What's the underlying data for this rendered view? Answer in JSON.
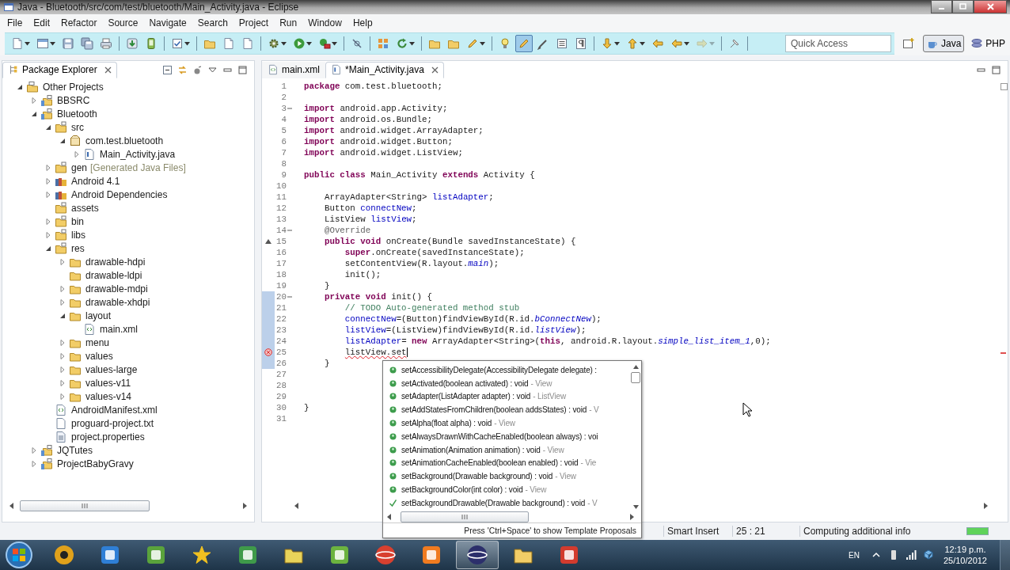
{
  "window": {
    "title": "Java - Bluetooth/src/com/test/bluetooth/Main_Activity.java - Eclipse"
  },
  "menu_bar": {
    "items": [
      "File",
      "Edit",
      "Refactor",
      "Source",
      "Navigate",
      "Search",
      "Project",
      "Run",
      "Window",
      "Help"
    ]
  },
  "toolbar": {
    "groups": [
      [
        {
          "kind": "document",
          "dropdown": true,
          "pressed": false,
          "disabled": false
        },
        {
          "kind": "window",
          "dropdown": true,
          "pressed": false,
          "disabled": false
        },
        {
          "kind": "disk",
          "dropdown": false,
          "pressed": false,
          "disabled": false
        },
        {
          "kind": "disks",
          "dropdown": false,
          "pressed": false,
          "disabled": false
        },
        {
          "kind": "printer",
          "dropdown": false,
          "pressed": false,
          "disabled": false
        }
      ],
      [
        {
          "kind": "download",
          "dropdown": false,
          "pressed": false,
          "disabled": false
        },
        {
          "kind": "phone",
          "dropdown": false,
          "pressed": false,
          "disabled": false
        }
      ],
      [
        {
          "kind": "checkbox",
          "dropdown": true,
          "pressed": false,
          "disabled": false
        }
      ],
      [
        {
          "kind": "folder",
          "dropdown": false,
          "pressed": false,
          "disabled": false
        },
        {
          "kind": "document",
          "dropdown": false,
          "pressed": false,
          "disabled": false
        },
        {
          "kind": "document",
          "dropdown": false,
          "pressed": false,
          "disabled": false
        }
      ],
      [
        {
          "kind": "gear",
          "dropdown": true,
          "pressed": false,
          "disabled": false
        },
        {
          "kind": "play",
          "dropdown": true,
          "pressed": false,
          "disabled": false
        },
        {
          "kind": "toolbox",
          "dropdown": true,
          "pressed": false,
          "disabled": false
        }
      ],
      [
        {
          "kind": "slash",
          "dropdown": false,
          "pressed": false,
          "disabled": false
        }
      ],
      [
        {
          "kind": "grid",
          "dropdown": false,
          "pressed": false,
          "disabled": false
        },
        {
          "kind": "refresh",
          "dropdown": true,
          "pressed": false,
          "disabled": false
        }
      ],
      [
        {
          "kind": "folder",
          "dropdown": false,
          "pressed": false,
          "disabled": false
        },
        {
          "kind": "folder",
          "dropdown": false,
          "pressed": false,
          "disabled": false
        },
        {
          "kind": "pencil",
          "dropdown": true,
          "pressed": false,
          "disabled": false
        }
      ],
      [
        {
          "kind": "lamp",
          "dropdown": false,
          "pressed": false,
          "disabled": false
        },
        {
          "kind": "pencil",
          "dropdown": false,
          "pressed": true,
          "disabled": false
        },
        {
          "kind": "pen",
          "dropdown": false,
          "pressed": false,
          "disabled": false
        },
        {
          "kind": "lines",
          "dropdown": false,
          "pressed": false,
          "disabled": false
        },
        {
          "kind": "paragraph",
          "dropdown": false,
          "pressed": false,
          "disabled": false
        }
      ],
      [
        {
          "kind": "arrow-down",
          "dropdown": true,
          "pressed": false,
          "disabled": false
        },
        {
          "kind": "arrow-up",
          "dropdown": true,
          "pressed": false,
          "disabled": false
        },
        {
          "kind": "arrow-left",
          "dropdown": false,
          "pressed": false,
          "disabled": false
        },
        {
          "kind": "arrow-left",
          "dropdown": true,
          "pressed": false,
          "disabled": false
        },
        {
          "kind": "arrow-right",
          "dropdown": true,
          "pressed": false,
          "disabled": true
        }
      ],
      [
        {
          "kind": "pin",
          "dropdown": false,
          "pressed": false,
          "disabled": false
        }
      ]
    ]
  },
  "quick_access": {
    "placeholder": "Quick Access"
  },
  "perspectives": [
    {
      "label": "Java",
      "selected": true
    },
    {
      "label": "PHP",
      "selected": false
    }
  ],
  "package_explorer": {
    "title": "Package Explorer",
    "tree": [
      {
        "label": "Other Projects",
        "kind": "working-set",
        "expandable": true,
        "expanded": true,
        "children": [
          {
            "label": "BBSRC",
            "kind": "project",
            "expandable": true,
            "expanded": false
          },
          {
            "label": "Bluetooth",
            "kind": "project",
            "expandable": true,
            "expanded": true,
            "children": [
              {
                "label": "src",
                "kind": "source-folder",
                "expandable": true,
                "expanded": true,
                "children": [
                  {
                    "label": "com.test.bluetooth",
                    "kind": "package",
                    "expandable": true,
                    "expanded": true,
                    "children": [
                      {
                        "label": "Main_Activity.java",
                        "kind": "java-file",
                        "expandable": true,
                        "expanded": false
                      }
                    ]
                  }
                ]
              },
              {
                "label": "gen",
                "decoration": "[Generated Java Files]",
                "kind": "source-folder",
                "expandable": true,
                "expanded": false
              },
              {
                "label": "Android 4.1",
                "kind": "library",
                "expandable": true,
                "expanded": false
              },
              {
                "label": "Android Dependencies",
                "kind": "library",
                "expandable": true,
                "expanded": false
              },
              {
                "label": "assets",
                "kind": "source-folder",
                "expandable": false,
                "expanded": false
              },
              {
                "label": "bin",
                "kind": "source-folder",
                "expandable": true,
                "expanded": false
              },
              {
                "label": "libs",
                "kind": "source-folder",
                "expandable": true,
                "expanded": false
              },
              {
                "label": "res",
                "kind": "source-folder",
                "expandable": true,
                "expanded": true,
                "children": [
                  {
                    "label": "drawable-hdpi",
                    "kind": "folder",
                    "expandable": true,
                    "expanded": false
                  },
                  {
                    "label": "drawable-ldpi",
                    "kind": "folder",
                    "expandable": false,
                    "expanded": false
                  },
                  {
                    "label": "drawable-mdpi",
                    "kind": "folder",
                    "expandable": true,
                    "expanded": false
                  },
                  {
                    "label": "drawable-xhdpi",
                    "kind": "folder",
                    "expandable": true,
                    "expanded": false
                  },
                  {
                    "label": "layout",
                    "kind": "folder",
                    "expandable": true,
                    "expanded": true,
                    "children": [
                      {
                        "label": "main.xml",
                        "kind": "xml-file",
                        "expandable": false,
                        "expanded": false
                      }
                    ]
                  },
                  {
                    "label": "menu",
                    "kind": "folder",
                    "expandable": true,
                    "expanded": false
                  },
                  {
                    "label": "values",
                    "kind": "folder",
                    "expandable": true,
                    "expanded": false
                  },
                  {
                    "label": "values-large",
                    "kind": "folder",
                    "expandable": true,
                    "expanded": false
                  },
                  {
                    "label": "values-v11",
                    "kind": "folder",
                    "expandable": true,
                    "expanded": false
                  },
                  {
                    "label": "values-v14",
                    "kind": "folder",
                    "expandable": true,
                    "expanded": false
                  }
                ]
              },
              {
                "label": "AndroidManifest.xml",
                "kind": "xml-file",
                "expandable": false,
                "expanded": false
              },
              {
                "label": "proguard-project.txt",
                "kind": "text-file",
                "expandable": false,
                "expanded": false
              },
              {
                "label": "project.properties",
                "kind": "properties-file",
                "expandable": false,
                "expanded": false
              }
            ]
          },
          {
            "label": "JQTutes",
            "kind": "project",
            "expandable": true,
            "expanded": false
          },
          {
            "label": "ProjectBabyGravy",
            "kind": "project",
            "expandable": true,
            "expanded": false
          }
        ]
      }
    ]
  },
  "editor": {
    "tabs": [
      {
        "label": "main.xml",
        "kind": "xml",
        "selected": false
      },
      {
        "label": "*Main_Activity.java",
        "kind": "java",
        "selected": true
      }
    ],
    "lines": [
      {
        "n": "1",
        "override": false,
        "error": false,
        "fold": false,
        "changed": false,
        "caret": false,
        "segs": [
          {
            "kind": "kw",
            "text": "package"
          },
          {
            "kind": "plain",
            "text": " com.test.bluetooth;"
          }
        ]
      },
      {
        "n": "2",
        "override": false,
        "error": false,
        "fold": false,
        "changed": false,
        "caret": false
      },
      {
        "n": "3",
        "override": false,
        "error": false,
        "fold": true,
        "changed": false,
        "caret": false,
        "segs": [
          {
            "kind": "kw",
            "text": "import"
          },
          {
            "kind": "plain",
            "text": " android.app.Activity;"
          }
        ]
      },
      {
        "n": "4",
        "override": false,
        "error": false,
        "fold": false,
        "changed": false,
        "caret": false,
        "segs": [
          {
            "kind": "kw",
            "text": "import"
          },
          {
            "kind": "plain",
            "text": " android.os.Bundle;"
          }
        ]
      },
      {
        "n": "5",
        "override": false,
        "error": false,
        "fold": false,
        "changed": false,
        "caret": false,
        "segs": [
          {
            "kind": "kw",
            "text": "import"
          },
          {
            "kind": "plain",
            "text": " android.widget.ArrayAdapter;"
          }
        ]
      },
      {
        "n": "6",
        "override": false,
        "error": false,
        "fold": false,
        "changed": false,
        "caret": false,
        "segs": [
          {
            "kind": "kw",
            "text": "import"
          },
          {
            "kind": "plain",
            "text": " android.widget.Button;"
          }
        ]
      },
      {
        "n": "7",
        "override": false,
        "error": false,
        "fold": false,
        "changed": false,
        "caret": false,
        "segs": [
          {
            "kind": "kw",
            "text": "import"
          },
          {
            "kind": "plain",
            "text": " android.widget.ListView;"
          }
        ]
      },
      {
        "n": "8",
        "override": false,
        "error": false,
        "fold": false,
        "changed": false,
        "caret": false
      },
      {
        "n": "9",
        "override": false,
        "error": false,
        "fold": false,
        "changed": false,
        "caret": false,
        "segs": [
          {
            "kind": "kw",
            "text": "public class"
          },
          {
            "kind": "plain",
            "text": " Main_Activity "
          },
          {
            "kind": "kw",
            "text": "extends"
          },
          {
            "kind": "plain",
            "text": " Activity {"
          }
        ]
      },
      {
        "n": "10",
        "override": false,
        "error": false,
        "fold": false,
        "changed": false,
        "caret": false
      },
      {
        "n": "11",
        "override": false,
        "error": false,
        "fold": false,
        "changed": false,
        "caret": false,
        "segs": [
          {
            "kind": "plain",
            "text": "    ArrayAdapter<String> "
          },
          {
            "kind": "field",
            "text": "listAdapter"
          },
          {
            "kind": "plain",
            "text": ";"
          }
        ]
      },
      {
        "n": "12",
        "override": false,
        "error": false,
        "fold": false,
        "changed": false,
        "caret": false,
        "segs": [
          {
            "kind": "plain",
            "text": "    Button "
          },
          {
            "kind": "field",
            "text": "connectNew"
          },
          {
            "kind": "plain",
            "text": ";"
          }
        ]
      },
      {
        "n": "13",
        "override": false,
        "error": false,
        "fold": false,
        "changed": false,
        "caret": false,
        "segs": [
          {
            "kind": "plain",
            "text": "    ListView "
          },
          {
            "kind": "field",
            "text": "listView"
          },
          {
            "kind": "plain",
            "text": ";"
          }
        ]
      },
      {
        "n": "14",
        "override": false,
        "error": false,
        "fold": true,
        "changed": false,
        "caret": false,
        "segs": [
          {
            "kind": "ann",
            "text": "    @Override"
          }
        ]
      },
      {
        "n": "15",
        "override": true,
        "error": false,
        "fold": false,
        "changed": false,
        "caret": false,
        "segs": [
          {
            "kind": "kw",
            "text": "    public void"
          },
          {
            "kind": "plain",
            "text": " onCreate(Bundle savedInstanceState) {"
          }
        ]
      },
      {
        "n": "16",
        "override": false,
        "error": false,
        "fold": false,
        "changed": false,
        "caret": false,
        "segs": [
          {
            "kind": "kw",
            "text": "        super"
          },
          {
            "kind": "plain",
            "text": ".onCreate(savedInstanceState);"
          }
        ]
      },
      {
        "n": "17",
        "override": false,
        "error": false,
        "fold": false,
        "changed": false,
        "caret": false,
        "segs": [
          {
            "kind": "plain",
            "text": "        setContentView(R.layout."
          },
          {
            "kind": "sfield",
            "text": "main"
          },
          {
            "kind": "plain",
            "text": ");"
          }
        ]
      },
      {
        "n": "18",
        "override": false,
        "error": false,
        "fold": false,
        "changed": false,
        "caret": false,
        "segs": [
          {
            "kind": "plain",
            "text": "        init();"
          }
        ]
      },
      {
        "n": "19",
        "override": false,
        "error": false,
        "fold": false,
        "changed": false,
        "caret": false,
        "segs": [
          {
            "kind": "plain",
            "text": "    }"
          }
        ]
      },
      {
        "n": "20",
        "override": false,
        "error": false,
        "fold": true,
        "changed": true,
        "caret": false,
        "segs": [
          {
            "kind": "kw",
            "text": "    private void"
          },
          {
            "kind": "plain",
            "text": " init() {"
          }
        ]
      },
      {
        "n": "21",
        "override": false,
        "error": false,
        "fold": false,
        "changed": true,
        "caret": false,
        "segs": [
          {
            "kind": "comment",
            "text": "        // TODO Auto-generated method stub"
          }
        ]
      },
      {
        "n": "22",
        "override": false,
        "error": false,
        "fold": false,
        "changed": true,
        "caret": false,
        "segs": [
          {
            "kind": "field",
            "text": "        connectNew"
          },
          {
            "kind": "plain",
            "text": "=(Button)findViewById(R.id."
          },
          {
            "kind": "sfield",
            "text": "bConnectNew"
          },
          {
            "kind": "plain",
            "text": ");"
          }
        ]
      },
      {
        "n": "23",
        "override": false,
        "error": false,
        "fold": false,
        "changed": true,
        "caret": false,
        "segs": [
          {
            "kind": "field",
            "text": "        listView"
          },
          {
            "kind": "plain",
            "text": "=(ListView)findViewById(R.id."
          },
          {
            "kind": "sfield",
            "text": "listView"
          },
          {
            "kind": "plain",
            "text": ");"
          }
        ]
      },
      {
        "n": "24",
        "override": false,
        "error": false,
        "fold": false,
        "changed": true,
        "caret": false,
        "segs": [
          {
            "kind": "field",
            "text": "        listAdapter"
          },
          {
            "kind": "plain",
            "text": "= "
          },
          {
            "kind": "kw",
            "text": "new"
          },
          {
            "kind": "plain",
            "text": " ArrayAdapter<String>("
          },
          {
            "kind": "kw",
            "text": "this"
          },
          {
            "kind": "plain",
            "text": ", android.R.layout."
          },
          {
            "kind": "sfield",
            "text": "simple_list_item_1"
          },
          {
            "kind": "plain",
            "text": ",0);"
          }
        ]
      },
      {
        "n": "25",
        "override": false,
        "error": true,
        "fold": false,
        "changed": true,
        "caret": true,
        "segs": [
          {
            "kind": "error",
            "text": "        listView.set"
          }
        ]
      },
      {
        "n": "26",
        "override": false,
        "error": false,
        "fold": false,
        "changed": true,
        "caret": false,
        "segs": [
          {
            "kind": "plain",
            "text": "    }"
          }
        ]
      },
      {
        "n": "27",
        "override": false,
        "error": false,
        "fold": false,
        "changed": false,
        "caret": false
      },
      {
        "n": "28",
        "override": false,
        "error": false,
        "fold": false,
        "changed": false,
        "caret": false
      },
      {
        "n": "29",
        "override": false,
        "error": false,
        "fold": false,
        "changed": false,
        "caret": false
      },
      {
        "n": "30",
        "override": false,
        "error": false,
        "fold": false,
        "changed": false,
        "caret": false,
        "segs": [
          {
            "kind": "plain",
            "text": "}"
          }
        ]
      },
      {
        "n": "31",
        "override": false,
        "error": false,
        "fold": false,
        "changed": false,
        "caret": false
      }
    ]
  },
  "proposals": {
    "items": [
      {
        "kind": "method",
        "signature": "setAccessibilityDelegate(AccessibilityDelegate delegate) :"
      },
      {
        "kind": "method",
        "signature": "setActivated(boolean activated) : void",
        "owner": "- View"
      },
      {
        "kind": "method",
        "signature": "setAdapter(ListAdapter adapter) : void",
        "owner": "- ListView"
      },
      {
        "kind": "method",
        "signature": "setAddStatesFromChildren(boolean addsStates) : void",
        "owner": "- V"
      },
      {
        "kind": "method",
        "signature": "setAlpha(float alpha) : void",
        "owner": "- View"
      },
      {
        "kind": "method",
        "signature": "setAlwaysDrawnWithCacheEnabled(boolean always) : voi"
      },
      {
        "kind": "method",
        "signature": "setAnimation(Animation animation) : void",
        "owner": "- View"
      },
      {
        "kind": "method",
        "signature": "setAnimationCacheEnabled(boolean enabled) : void",
        "owner": "- Vie"
      },
      {
        "kind": "method",
        "signature": "setBackground(Drawable background) : void",
        "owner": "- View"
      },
      {
        "kind": "method",
        "signature": "setBackgroundColor(int color) : void",
        "owner": "- View"
      },
      {
        "kind": "deprecated",
        "signature": "setBackgroundDrawable(Drawable background) : void",
        "owner": "- V"
      }
    ],
    "footer": "Press 'Ctrl+Space' to show Template Proposals"
  },
  "status_bar": {
    "insert_mode": "Smart Insert",
    "position": "25 : 21",
    "message": "Computing additional info",
    "progress": {
      "level": 1
    }
  },
  "taskbar": {
    "items": [
      {
        "kind": "disc",
        "color": "#e0a11b",
        "active": false
      },
      {
        "kind": "tile",
        "color": "#2f7fd6",
        "active": false
      },
      {
        "kind": "tile",
        "color": "#5aa33c",
        "active": false
      },
      {
        "kind": "star",
        "color": "#f0c020",
        "active": false
      },
      {
        "kind": "tile",
        "color": "#3f9a4a",
        "active": false
      },
      {
        "kind": "folder",
        "color": "#e8d35a",
        "active": false
      },
      {
        "kind": "tile",
        "color": "#6cb33f",
        "active": false
      },
      {
        "kind": "ball",
        "color": "#d8402f",
        "active": false
      },
      {
        "kind": "tile",
        "color": "#f07b20",
        "active": false
      },
      {
        "kind": "ball",
        "color": "#2c2f6b",
        "active": true
      },
      {
        "kind": "folder",
        "color": "#f2cd67",
        "active": false
      },
      {
        "kind": "tile",
        "color": "#d23b2e",
        "active": false
      }
    ],
    "language": "EN",
    "time": "12:19 p.m.",
    "date": "25/10/2012"
  }
}
